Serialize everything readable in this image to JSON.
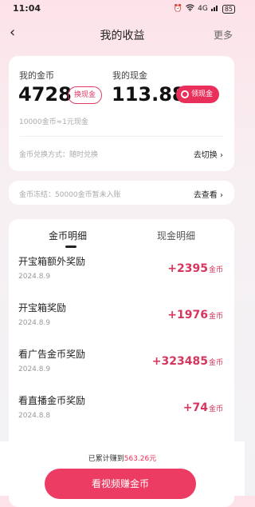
{
  "status": {
    "time": "11:04",
    "signal": "4G",
    "battery": "85"
  },
  "header": {
    "title": "我的收益",
    "more": "更多"
  },
  "balance": {
    "coin_label": "我的金币",
    "coin_value": "4728",
    "exchange_btn": "换现金",
    "cash_label": "我的现金",
    "cash_value": "113.88",
    "withdraw_btn": "领现金",
    "rate": "10000金币≈1元现金",
    "mode": "金币兑换方式：随时兑换",
    "switch_link": "去切换 ›"
  },
  "freeze": {
    "text": "金币冻结：50000金币暂未入账",
    "link": "去查看 ›"
  },
  "tabs": {
    "coin": "金币明细",
    "cash": "现金明细"
  },
  "records": [
    {
      "title": "开宝箱额外奖励",
      "date": "2024.8.9",
      "amount": "+2395",
      "unit": "金币"
    },
    {
      "title": "开宝箱奖励",
      "date": "2024.8.9",
      "amount": "+1976",
      "unit": "金币"
    },
    {
      "title": "看广告金币奖励",
      "date": "2024.8.9",
      "amount": "+323485",
      "unit": "金币"
    },
    {
      "title": "看直播金币奖励",
      "date": "2024.8.8",
      "amount": "+74",
      "unit": "金币"
    }
  ],
  "footer": {
    "total_prefix": "已累计赚到",
    "total_value": "563.26元",
    "cta": "看视频赚金币"
  },
  "colors": {
    "accent": "#e8305a",
    "amount": "#d6365d"
  }
}
